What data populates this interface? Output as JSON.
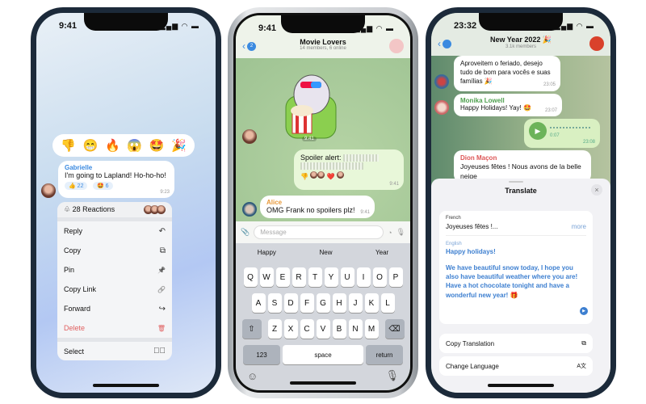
{
  "phone1": {
    "time": "9:41",
    "reaction_bar": [
      "👎",
      "😁",
      "🔥",
      "😱",
      "🤩",
      "🎉"
    ],
    "message": {
      "sender": "Gabrielle",
      "text": "I'm going to Lapland! Ho-ho-ho!",
      "time": "9:23",
      "reactions": [
        {
          "emoji": "👍",
          "count": "22"
        },
        {
          "emoji": "🤩",
          "count": "6"
        }
      ]
    },
    "context_menu": {
      "reactions_label": "28 Reactions",
      "items": [
        {
          "label": "Reply",
          "icon": "↶"
        },
        {
          "label": "Copy",
          "icon": "⧉"
        },
        {
          "label": "Pin",
          "icon": "📌"
        },
        {
          "label": "Copy Link",
          "icon": "🔗"
        },
        {
          "label": "Forward",
          "icon": "↪"
        },
        {
          "label": "Delete",
          "icon": "🗑"
        }
      ],
      "select_label": "Select",
      "delete_color": "#e06060"
    }
  },
  "phone2": {
    "time": "9:41",
    "back_badge": "2",
    "chat_title": "Movie Lovers",
    "chat_subtitle": "14 members, 6 online",
    "sticker_time": "9:41",
    "spoiler_message": {
      "text": "Spoiler alert:",
      "time": "9:41",
      "reactions": [
        "👎",
        "❤️"
      ]
    },
    "alice_message": {
      "sender": "Alice",
      "text": "OMG Frank no spoilers plz!",
      "time": "9:41"
    },
    "input_placeholder": "Message",
    "suggestions": [
      "Happy",
      "New",
      "Year"
    ],
    "keyboard": {
      "row1": [
        "Q",
        "W",
        "E",
        "R",
        "T",
        "Y",
        "U",
        "I",
        "O",
        "P"
      ],
      "row2": [
        "A",
        "S",
        "D",
        "F",
        "G",
        "H",
        "J",
        "K",
        "L"
      ],
      "row3": [
        "Z",
        "X",
        "C",
        "V",
        "B",
        "N",
        "M"
      ],
      "numbers": "123",
      "space": "space",
      "return": "return"
    }
  },
  "phone3": {
    "time": "23:32",
    "chat_title": "New Year 2022 🎉",
    "chat_subtitle": "3.1k members",
    "messages": [
      {
        "text": "Aproveitem o feriado, desejo tudo de bom para vocês e suas famílias 🎉",
        "time": "23:05"
      },
      {
        "sender": "Monika Lowell",
        "text": "Happy Holidays! Yay! 🤩",
        "time": "23:07"
      },
      {
        "voice_duration": "0:07",
        "time": "23:08"
      },
      {
        "sender": "Dion Maçon",
        "text": "Joyeuses fêtes ! Nous avons de la belle neige"
      }
    ],
    "translate": {
      "title": "Translate",
      "source_lang": "French",
      "source_text": "Joyeuses fêtes !...",
      "more": "more",
      "target_lang": "English",
      "target_title": "Happy holidays!",
      "target_text": "We have beautiful snow today, I hope you also have beautiful weather where you are! Have a hot chocolate tonight and have a wonderful new year! 🎁",
      "copy_translation": "Copy Translation",
      "change_language": "Change Language"
    }
  }
}
